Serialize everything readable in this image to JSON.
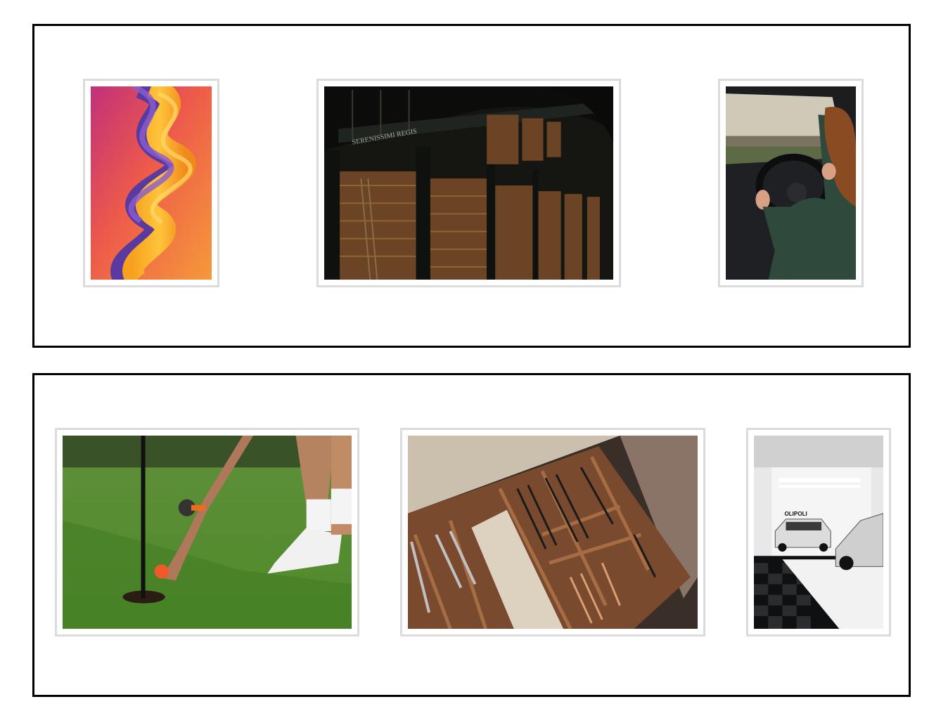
{
  "gallery": {
    "rows": [
      {
        "photos": [
          {
            "subject": "abstract orange and purple swirl artwork"
          },
          {
            "subject": "old library with tall wooden bookshelves"
          },
          {
            "subject": "person driving a car"
          }
        ]
      },
      {
        "photos": [
          {
            "subject": "golfer placing orange ball near hole"
          },
          {
            "subject": "drawer with wooden cutlery organizer"
          },
          {
            "subject": "white cars in a garage"
          }
        ]
      }
    ],
    "library_sign_text": "SERENISSIMI REGIS",
    "garage_sign_text": "OLIPOLI",
    "colors": {
      "row_border": "#000000",
      "frame_border": "#dcdcdc",
      "background": "#ffffff"
    }
  }
}
